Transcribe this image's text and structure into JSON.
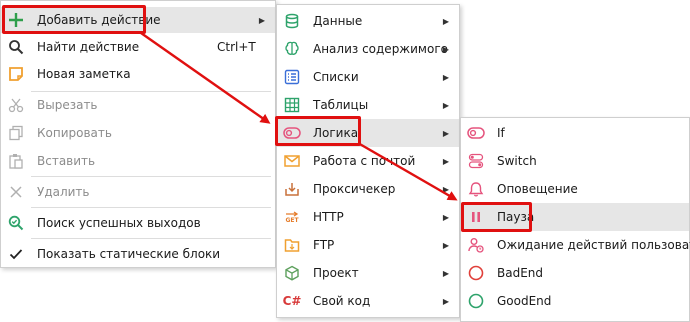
{
  "menu1": {
    "items": [
      {
        "label": "Добавить действие",
        "icon": "plus-icon",
        "submenu": true
      },
      {
        "label": "Найти действие",
        "icon": "search-icon",
        "shortcut": "Ctrl+T"
      },
      {
        "label": "Новая заметка",
        "icon": "note-icon"
      },
      {
        "label": "Вырезать",
        "icon": "scissors-icon",
        "disabled": true
      },
      {
        "label": "Копировать",
        "icon": "copy-icon",
        "disabled": true
      },
      {
        "label": "Вставить",
        "icon": "paste-icon",
        "disabled": true
      },
      {
        "label": "Удалить",
        "icon": "x-icon",
        "disabled": true
      },
      {
        "label": "Поиск успешных выходов",
        "icon": "search-check-icon"
      },
      {
        "label": "Показать статические блоки",
        "icon": "check-icon"
      }
    ]
  },
  "menu2": {
    "items": [
      {
        "label": "Данные",
        "icon": "database-icon"
      },
      {
        "label": "Анализ содержимого",
        "icon": "brain-icon"
      },
      {
        "label": "Списки",
        "icon": "list-icon"
      },
      {
        "label": "Таблицы",
        "icon": "table-icon"
      },
      {
        "label": "Логика",
        "icon": "toggle-icon"
      },
      {
        "label": "Работа с почтой",
        "icon": "mail-icon"
      },
      {
        "label": "Проксичекер",
        "icon": "proxy-icon"
      },
      {
        "label": "HTTP",
        "icon": "http-get-icon",
        "icon_text": "GET"
      },
      {
        "label": "FTP",
        "icon": "ftp-icon"
      },
      {
        "label": "Проект",
        "icon": "cube-icon"
      },
      {
        "label": "Свой код",
        "icon": "csharp-icon",
        "icon_text": "C#"
      }
    ]
  },
  "menu3": {
    "items": [
      {
        "label": "If",
        "icon": "toggle-icon"
      },
      {
        "label": "Switch",
        "icon": "switch-icon"
      },
      {
        "label": "Оповещение",
        "icon": "bell-icon"
      },
      {
        "label": "Пауза",
        "icon": "pause-icon"
      },
      {
        "label": "Ожидание действий пользователя",
        "icon": "user-wait-icon"
      },
      {
        "label": "BadEnd",
        "icon": "badend-icon"
      },
      {
        "label": "GoodEnd",
        "icon": "goodend-icon"
      }
    ]
  },
  "colors": {
    "highlight": "#e6e6e6",
    "annotation_red": "#e01010",
    "plus_green": "#2e9e4b",
    "pink": "#e5537d",
    "orange": "#f0a030",
    "blue": "#3a6fd8",
    "green": "#2ea36b"
  }
}
